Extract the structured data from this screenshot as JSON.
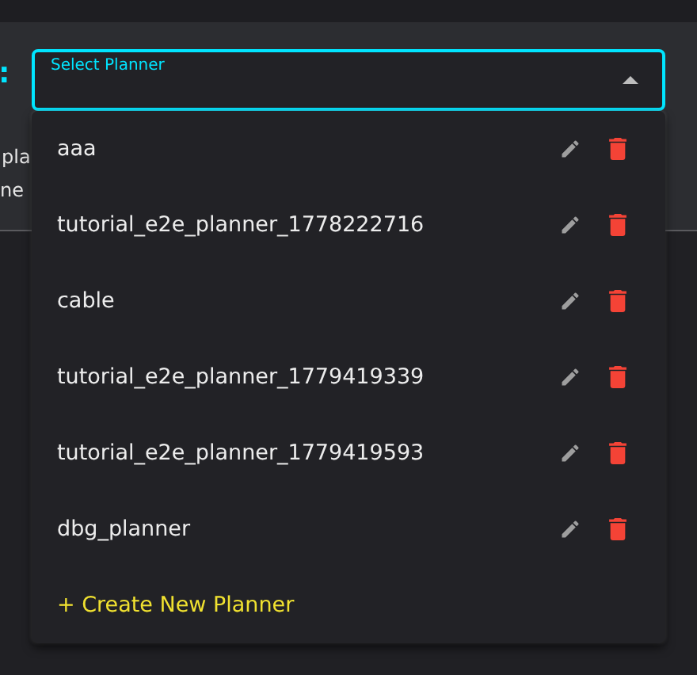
{
  "background_text": [
    ":",
    "pla",
    "ne"
  ],
  "select": {
    "label": "Select Planner",
    "expanded": true
  },
  "menu": {
    "items": [
      {
        "name": "aaa"
      },
      {
        "name": "tutorial_e2e_planner_1778222716"
      },
      {
        "name": "cable"
      },
      {
        "name": "tutorial_e2e_planner_1779419339"
      },
      {
        "name": "tutorial_e2e_planner_1779419593"
      },
      {
        "name": "dbg_planner"
      }
    ],
    "create_label": "+ Create New Planner"
  }
}
